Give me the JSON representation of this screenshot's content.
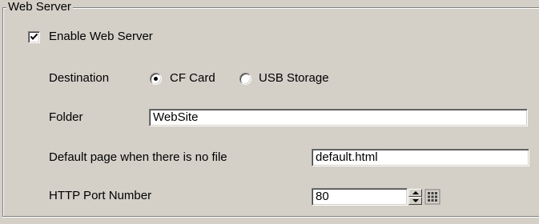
{
  "group": {
    "title": "Web Server"
  },
  "enable": {
    "label": "Enable Web Server",
    "checked": true
  },
  "destination": {
    "label": "Destination",
    "options": [
      {
        "label": "CF Card",
        "selected": true
      },
      {
        "label": "USB Storage",
        "selected": false
      }
    ]
  },
  "folder": {
    "label": "Folder",
    "value": "WebSite"
  },
  "default_page": {
    "label": "Default page when there is no file",
    "value": "default.html"
  },
  "http_port": {
    "label": "HTTP Port Number",
    "value": "80"
  },
  "icons": {
    "check": "checkmark-icon",
    "spin_up": "arrow-up-icon",
    "spin_down": "arrow-down-icon",
    "keypad": "keypad-icon"
  }
}
